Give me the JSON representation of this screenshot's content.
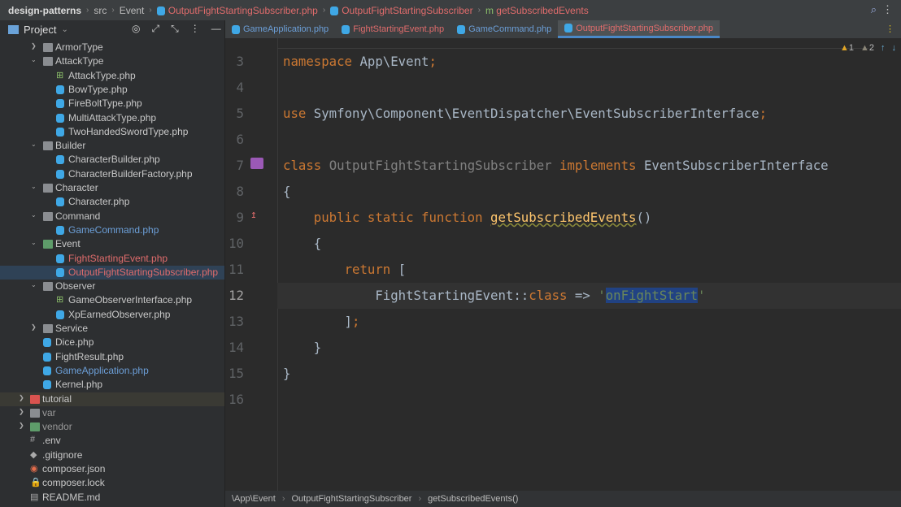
{
  "nav": {
    "project": "design-patterns",
    "crumbs": [
      "src",
      "Event"
    ],
    "file": "OutputFightStartingSubscriber.php",
    "class": "OutputFightStartingSubscriber",
    "method": "getSubscribedEvents"
  },
  "sidebar": {
    "title": "Project",
    "items": [
      {
        "name": "ArmorType",
        "level": 1,
        "type": "folder",
        "arrow": "›"
      },
      {
        "name": "AttackType",
        "level": 1,
        "type": "folder",
        "arrow": "⌄"
      },
      {
        "name": "AttackType.php",
        "level": 2,
        "type": "iface"
      },
      {
        "name": "BowType.php",
        "level": 2,
        "type": "file"
      },
      {
        "name": "FireBoltType.php",
        "level": 2,
        "type": "file"
      },
      {
        "name": "MultiAttackType.php",
        "level": 2,
        "type": "file"
      },
      {
        "name": "TwoHandedSwordType.php",
        "level": 2,
        "type": "file"
      },
      {
        "name": "Builder",
        "level": 1,
        "type": "folder",
        "arrow": "⌄"
      },
      {
        "name": "CharacterBuilder.php",
        "level": 2,
        "type": "file"
      },
      {
        "name": "CharacterBuilderFactory.php",
        "level": 2,
        "type": "file"
      },
      {
        "name": "Character",
        "level": 1,
        "type": "folder",
        "arrow": "⌄"
      },
      {
        "name": "Character.php",
        "level": 2,
        "type": "file"
      },
      {
        "name": "Command",
        "level": 1,
        "type": "folder",
        "arrow": "⌄"
      },
      {
        "name": "GameCommand.php",
        "level": 2,
        "type": "file",
        "color": "#6c9fd8"
      },
      {
        "name": "Event",
        "level": 1,
        "type": "folder green",
        "arrow": "⌄"
      },
      {
        "name": "FightStartingEvent.php",
        "level": 2,
        "type": "file",
        "color": "#e06c6c"
      },
      {
        "name": "OutputFightStartingSubscriber.php",
        "level": 2,
        "type": "file",
        "color": "#e06c6c",
        "selected": true
      },
      {
        "name": "Observer",
        "level": 1,
        "type": "folder",
        "arrow": "⌄"
      },
      {
        "name": "GameObserverInterface.php",
        "level": 2,
        "type": "iface"
      },
      {
        "name": "XpEarnedObserver.php",
        "level": 2,
        "type": "file"
      },
      {
        "name": "Service",
        "level": 1,
        "type": "folder",
        "arrow": "›"
      },
      {
        "name": "Dice.php",
        "level": 1.5,
        "type": "file"
      },
      {
        "name": "FightResult.php",
        "level": 1.5,
        "type": "file"
      },
      {
        "name": "GameApplication.php",
        "level": 1.5,
        "type": "file",
        "color": "#6c9fd8"
      },
      {
        "name": "Kernel.php",
        "level": 1.5,
        "type": "file"
      },
      {
        "name": "tutorial",
        "level": 0,
        "type": "folder red",
        "arrow": "›",
        "highlight": true
      },
      {
        "name": "var",
        "level": 0,
        "type": "folder",
        "arrow": "›",
        "color": "#999"
      },
      {
        "name": "vendor",
        "level": 0,
        "type": "folder green",
        "arrow": "›",
        "color": "#999"
      },
      {
        "name": ".env",
        "level": 0.5,
        "type": "misc"
      },
      {
        "name": ".gitignore",
        "level": 0.5,
        "type": "misc"
      },
      {
        "name": "composer.json",
        "level": 0.5,
        "type": "gitf"
      },
      {
        "name": "composer.lock",
        "level": 0.5,
        "type": "lockf"
      },
      {
        "name": "README.md",
        "level": 0.5,
        "type": "misc"
      }
    ]
  },
  "tabs": [
    {
      "label": "GameApplication.php"
    },
    {
      "label": "FightStartingEvent.php",
      "red": true
    },
    {
      "label": "GameCommand.php"
    },
    {
      "label": "OutputFightStartingSubscriber.php",
      "red": true,
      "active": true
    }
  ],
  "inspections": {
    "warnings": "1",
    "weak_warnings": "2"
  },
  "code": [
    {
      "n": "3",
      "html": "<span class='k'>namespace</span> App\\Event<span class='k'>;</span>"
    },
    {
      "n": "4",
      "html": ""
    },
    {
      "n": "5",
      "html": "<span class='k'>use</span> Symfony\\Component\\EventDispatcher\\EventSubscriberInterface<span class='k'>;</span>"
    },
    {
      "n": "6",
      "html": ""
    },
    {
      "n": "7",
      "html": "<span class='k'>class</span> <span class='g'>OutputFightStartingSubscriber</span> <span class='k'>implements</span> EventSubscriberInterface"
    },
    {
      "n": "8",
      "html": "{"
    },
    {
      "n": "9",
      "html": "    <span class='k'>public static function</span> <span class='f'>getSubscribedEvents</span>()"
    },
    {
      "n": "10",
      "html": "    {"
    },
    {
      "n": "11",
      "html": "        <span class='k'>return</span> ["
    },
    {
      "n": "12",
      "html": "            FightStartingEvent::<span class='k'>class</span> => <span class='s'>'</span><span class='sel2'>onFightStart</span><span class='s'>'</span>",
      "current": true
    },
    {
      "n": "13",
      "html": "        ]<span class='k'>;</span>"
    },
    {
      "n": "14",
      "html": "    }"
    },
    {
      "n": "15",
      "html": "}"
    },
    {
      "n": "16",
      "html": ""
    }
  ],
  "status": {
    "crumbs": [
      "\\App\\Event",
      "OutputFightStartingSubscriber",
      "getSubscribedEvents()"
    ]
  }
}
